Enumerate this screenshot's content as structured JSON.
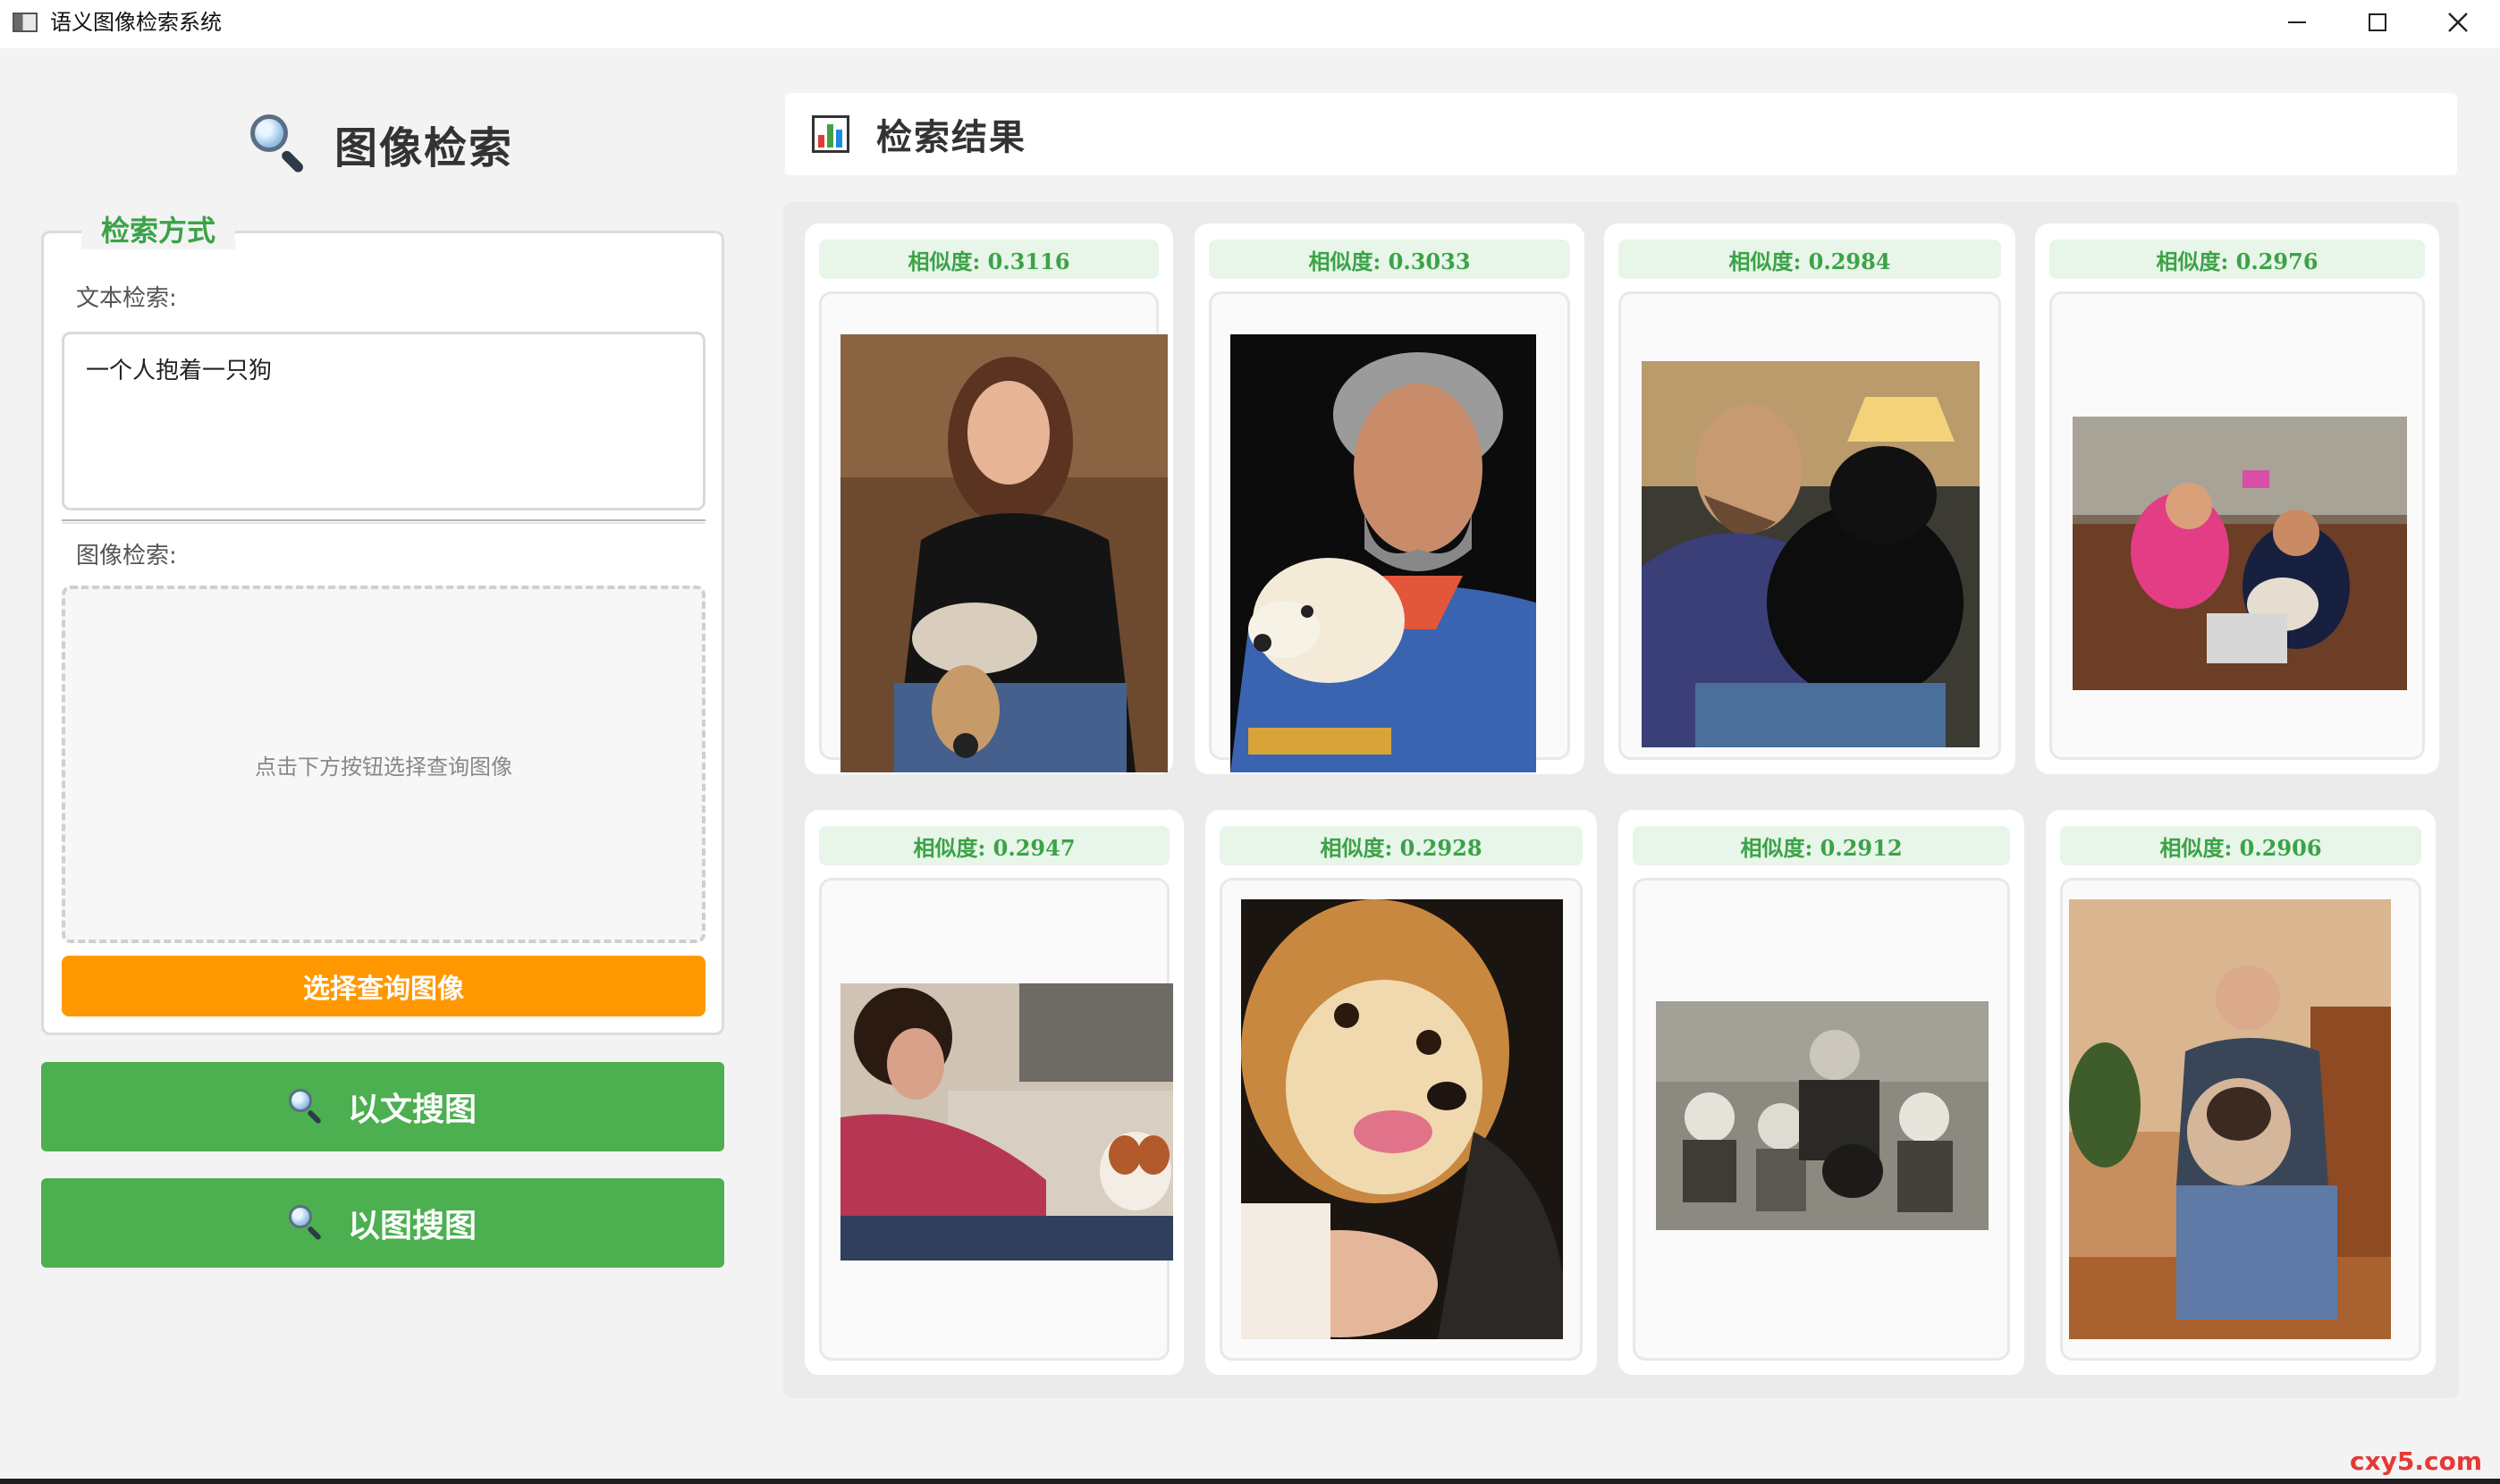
{
  "window": {
    "title": "语义图像检索系统"
  },
  "search_panel": {
    "title": "图像检索",
    "group_title": "检索方式",
    "text_label": "文本检索:",
    "text_value": "一个人抱着一只狗",
    "image_label": "图像检索:",
    "image_placeholder": "点击下方按钮选择查询图像",
    "choose_button": "选择查询图像",
    "text_search_button": "以文搜图",
    "image_search_button": "以图搜图"
  },
  "results": {
    "title": "检索结果",
    "items": [
      {
        "score": "相似度: 0.3116",
        "description": "woman on couch holding a small dog"
      },
      {
        "score": "相似度: 0.3033",
        "description": "smiling man in blue sweater holding a dog"
      },
      {
        "score": "相似度: 0.2984",
        "description": "bearded man holding a black dog"
      },
      {
        "score": "相似度: 0.2976",
        "description": "girl and man on couch with a dog and laptop"
      },
      {
        "score": "相似度: 0.2947",
        "description": "young man on sofa with a small spaniel"
      },
      {
        "score": "相似度: 0.2928",
        "description": "close-up of a light brown dog being held"
      },
      {
        "score": "相似度: 0.2912",
        "description": "old black-and-white photo of children with a dog"
      },
      {
        "score": "相似度: 0.2906",
        "description": "man in chair holding a pug"
      }
    ]
  },
  "watermark": "cxy5.com",
  "colors": {
    "accent_green": "#4caf50",
    "label_green": "#3aa347",
    "accent_orange": "#ff9800",
    "score_bg": "#e8f5e9"
  }
}
